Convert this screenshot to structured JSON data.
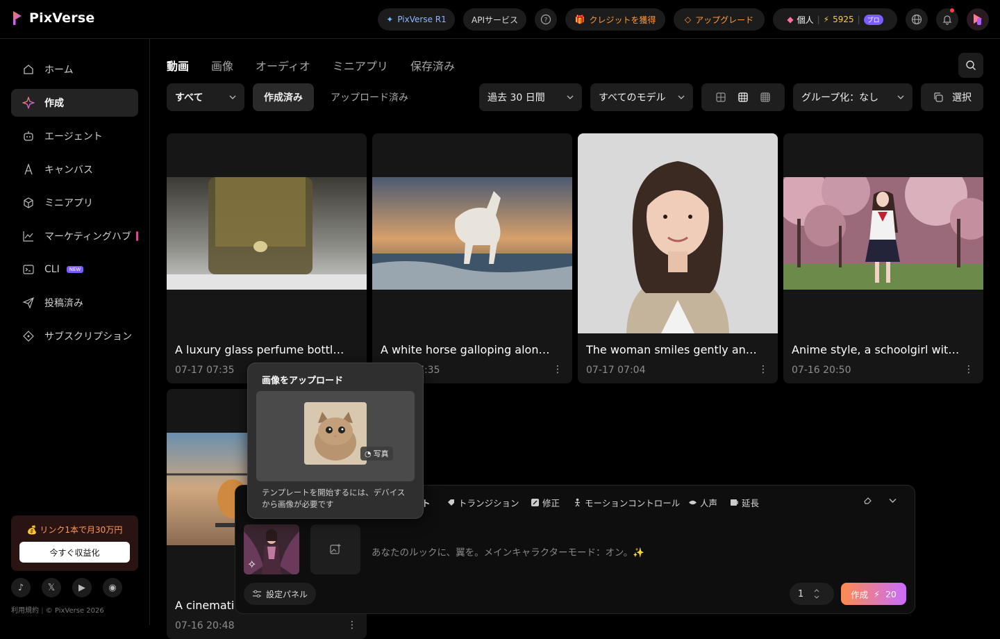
{
  "app": {
    "name": "PixVerse"
  },
  "topbar": {
    "model_label": "PixVerse R1",
    "api_label": "APIサービス",
    "credits_label": "クレジットを獲得",
    "upgrade_label": "アップグレード",
    "account_label": "個人",
    "credits_value": "5925",
    "plan_badge": "プロ"
  },
  "sidebar": {
    "items": [
      {
        "label": "ホーム",
        "icon": "home-icon"
      },
      {
        "label": "作成",
        "icon": "sparkle-icon",
        "active": true
      },
      {
        "label": "エージェント",
        "icon": "robot-icon"
      },
      {
        "label": "キャンバス",
        "icon": "canvas-icon"
      },
      {
        "label": "ミニアプリ",
        "icon": "cube-icon"
      },
      {
        "label": "マーケティングハブ",
        "icon": "chart-icon"
      },
      {
        "label": "CLI",
        "icon": "terminal-icon",
        "badge": "NEW"
      },
      {
        "label": "投稿済み",
        "icon": "send-icon"
      },
      {
        "label": "サブスクリプション",
        "icon": "diamond-icon"
      }
    ],
    "promo_text": "💰 リンク1本で月30万円",
    "promo_button": "今すぐ収益化",
    "footer_terms": "利用規約",
    "footer_copy": "© PixVerse 2026"
  },
  "tabs": [
    "動画",
    "画像",
    "オーディオ",
    "ミニアプリ",
    "保存済み"
  ],
  "filters": {
    "type": "すべて",
    "created": "作成済み",
    "uploaded": "アップロード済み",
    "period": "過去 30 日間",
    "model": "すべてのモデル",
    "group": "グループ化：なし",
    "select": "選択"
  },
  "cards": [
    {
      "title": "A luxury glass perfume bottle_...",
      "date": "07-17  07:35"
    },
    {
      "title": "A white horse galloping along...",
      "date": "07-17  07:35"
    },
    {
      "title": "The woman smiles gently and t...",
      "date": "07-17  07:04"
    },
    {
      "title": "Anime style, a schoolgirl with_...",
      "date": "07-16  20:50"
    },
    {
      "title": "A cinematic",
      "date": "07-16  20:48"
    }
  ],
  "tooltip": {
    "title": "画像をアップロード",
    "tag": "写真",
    "desc": "テンプレートを開始するには、デバイスから画像が必要です"
  },
  "composer": {
    "tabs": [
      "ト",
      "トランジション",
      "修正",
      "モーションコントロール",
      "人声",
      "延長"
    ],
    "prompt": "あなたのルックに、翼を。メインキャラクターモード：オン。✨",
    "settings": "設定パネル",
    "quantity": "1",
    "create": "作成",
    "cost": "20"
  }
}
